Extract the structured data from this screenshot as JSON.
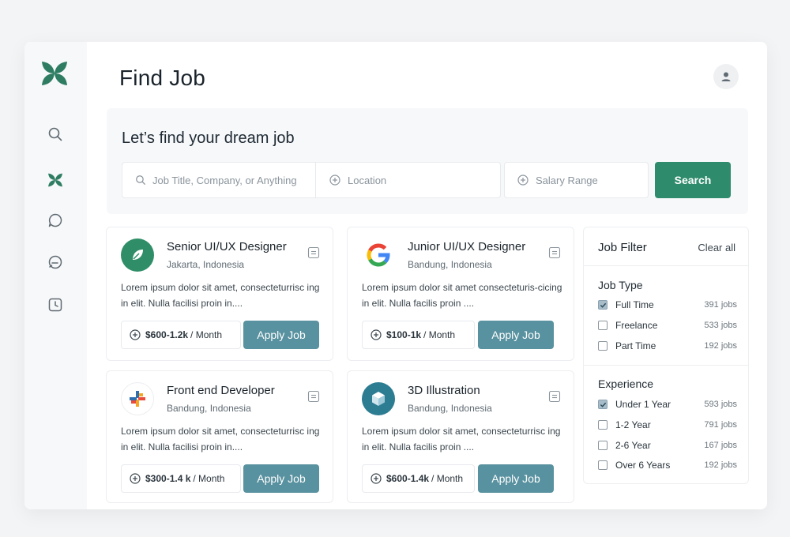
{
  "page": {
    "title": "Find Job"
  },
  "sidebar": {
    "items": [
      "search-icon",
      "leaf-logo-icon",
      "chat-bubble-icon",
      "message-icon",
      "clock-icon"
    ]
  },
  "hero": {
    "title": "Let’s find your dream job",
    "search_placeholder": "Job Title, Company, or Anything",
    "location_placeholder": "Location",
    "salary_placeholder": "Salary Range",
    "search_button": "Search"
  },
  "jobs": [
    {
      "title": "Senior UI/UX Designer",
      "location": "Jakarta, Indonesia",
      "description": "Lorem ipsum dolor sit amet, consecteturrisc ing in elit. Nulla facilisi proin in....",
      "salary": "$600-1.2k",
      "period": "/ Month",
      "apply": "Apply Job"
    },
    {
      "title": "Junior UI/UX Designer",
      "location": "Bandung, Indonesia",
      "description": "Lorem ipsum dolor sit amet consecteturis-cicing in elit. Nulla facilis proin ....",
      "salary": "$100-1k",
      "period": "/ Month",
      "apply": "Apply Job"
    },
    {
      "title": "Front end Developer",
      "location": "Bandung, Indonesia",
      "description": "Lorem ipsum dolor sit amet, consecteturrisc ing in elit. Nulla facilisi proin in....",
      "salary": "$300-1.4 k",
      "period": "/ Month",
      "apply": "Apply Job"
    },
    {
      "title": "3D Illustration",
      "location": "Bandung, Indonesia",
      "description": "Lorem ipsum dolor sit amet, consecteturrisc ing in elit. Nulla facilis proin ....",
      "salary": "$600-1.4k",
      "period": "/ Month",
      "apply": "Apply Job"
    }
  ],
  "filter": {
    "title": "Job Filter",
    "clear": "Clear all",
    "job_type": {
      "title": "Job Type",
      "options": [
        {
          "label": "Full Time",
          "count": "391 jobs",
          "checked": true
        },
        {
          "label": "Freelance",
          "count": "533 jobs",
          "checked": false
        },
        {
          "label": "Part Time",
          "count": "192 jobs",
          "checked": false
        }
      ]
    },
    "experience": {
      "title": "Experience",
      "options": [
        {
          "label": "Under 1 Year",
          "count": "593 jobs",
          "checked": true
        },
        {
          "label": "1-2 Year",
          "count": "791 jobs",
          "checked": false
        },
        {
          "label": "2-6 Year",
          "count": "167 jobs",
          "checked": false
        },
        {
          "label": "Over 6 Years",
          "count": "192 jobs",
          "checked": false
        }
      ]
    }
  },
  "colors": {
    "brand": "#2e8b6c",
    "apply": "#58919f",
    "background": "#f3f4f5"
  }
}
